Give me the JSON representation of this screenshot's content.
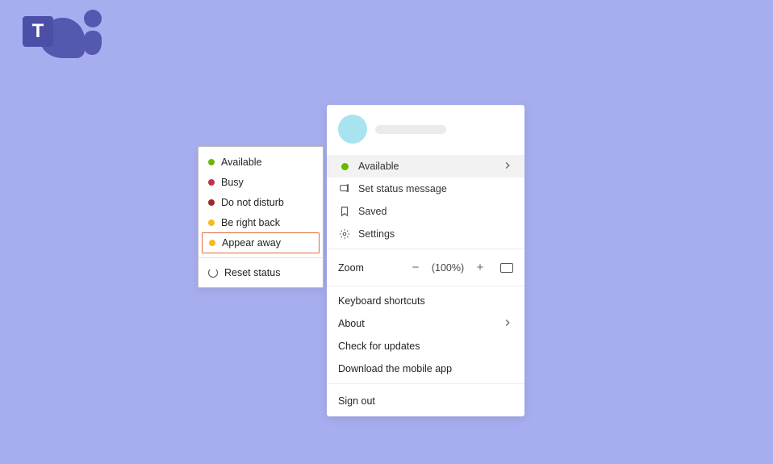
{
  "colors": {
    "available": "#6bb700",
    "busy": "#c4314b",
    "dnd": "#a4262c",
    "away": "#fdb913"
  },
  "profile_menu": {
    "status": {
      "label": "Available"
    },
    "set_status": {
      "label": "Set status message"
    },
    "saved": {
      "label": "Saved"
    },
    "settings": {
      "label": "Settings"
    },
    "zoom": {
      "label": "Zoom",
      "value": "(100%)"
    },
    "shortcuts": {
      "label": "Keyboard shortcuts"
    },
    "about": {
      "label": "About"
    },
    "updates": {
      "label": "Check for updates"
    },
    "mobile": {
      "label": "Download the mobile app"
    },
    "signout": {
      "label": "Sign out"
    }
  },
  "status_menu": {
    "options": [
      {
        "label": "Available"
      },
      {
        "label": "Busy"
      },
      {
        "label": "Do not disturb"
      },
      {
        "label": "Be right back"
      },
      {
        "label": "Appear away"
      }
    ],
    "reset": {
      "label": "Reset status"
    }
  }
}
